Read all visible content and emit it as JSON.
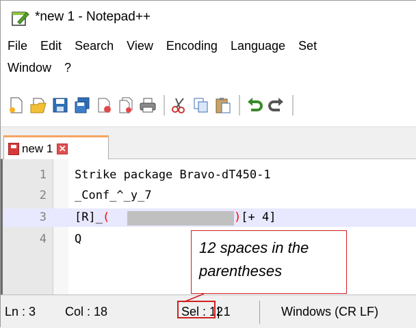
{
  "window": {
    "title": "*new 1 - Notepad++"
  },
  "menu": {
    "row1": [
      "File",
      "Edit",
      "Search",
      "View",
      "Encoding",
      "Language",
      "Set"
    ],
    "row2": [
      "Window",
      "?"
    ]
  },
  "toolbar": {
    "icons": [
      "new-file-icon",
      "open-file-icon",
      "save-icon",
      "save-all-icon",
      "close-icon",
      "close-all-icon",
      "print-icon",
      "cut-icon",
      "copy-icon",
      "paste-icon",
      "undo-icon",
      "redo-icon"
    ]
  },
  "tab": {
    "label": "new 1",
    "close": "✕"
  },
  "editor": {
    "lines": [
      {
        "num": "1",
        "text": "Strike package Bravo-dT450-1"
      },
      {
        "num": "2",
        "text": "_Conf_^_y_7"
      },
      {
        "num": "3",
        "prefix": "[R]_",
        "open_paren": "(",
        "close_paren": ")",
        "suffix": "[+ 4]"
      },
      {
        "num": "4",
        "text": "Q"
      }
    ],
    "current_line": 3
  },
  "status": {
    "ln": "Ln : 3",
    "col": "Col : 18",
    "sel": "Sel : 12",
    "sel_rest": "| 1",
    "eol": "Windows (CR LF)"
  },
  "annotation": {
    "line1": "12 spaces in the",
    "line2": "parentheses"
  },
  "colors": {
    "accent": "#d11f1f",
    "current_line": "#e8e8ff",
    "selection": "#c0c0c0"
  }
}
